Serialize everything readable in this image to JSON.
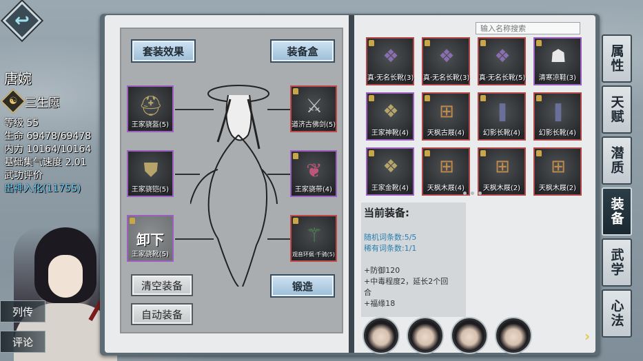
{
  "character": {
    "name": "唐婉",
    "trait": "三生愿",
    "stats": [
      {
        "label": "等级",
        "value": "55"
      },
      {
        "label": "生命",
        "value": "69478/69478"
      },
      {
        "label": "内力",
        "value": "10164/10164"
      },
      {
        "label": "基础集气速度",
        "value": "2.01"
      },
      {
        "label": "武功评价",
        "value": ""
      }
    ],
    "rating": "出神入化(11755)"
  },
  "side_buttons": {
    "biography": "列传",
    "comment": "评论"
  },
  "left_page": {
    "set_effect": "套装效果",
    "equip_box": "装备盒",
    "clear_equip": "清空装备",
    "auto_equip": "自动装备",
    "forge": "锻造",
    "unequip_label": "卸下",
    "slots": {
      "head": "王家骁盔(5)",
      "weapon": "道济古佛剑(5)",
      "armor": "王家骁铠(5)",
      "belt": "王家骁带(4)",
      "boots": "王家骁靴(5)",
      "accessory": "观音环佩·千骑(5)"
    }
  },
  "search": {
    "placeholder": "输入名称搜索"
  },
  "inventory": [
    {
      "name": "真·无名长靴(3)",
      "rarity": "red"
    },
    {
      "name": "真·无名长靴(3)",
      "rarity": "red"
    },
    {
      "name": "真·无名长靴(5)",
      "rarity": "red"
    },
    {
      "name": "清寒凉鞋(3)",
      "rarity": "purple"
    },
    {
      "name": "王家神靴(4)",
      "rarity": "purple"
    },
    {
      "name": "天枫古屐(4)",
      "rarity": "red"
    },
    {
      "name": "幻影长靴(4)",
      "rarity": "red"
    },
    {
      "name": "幻影长靴(4)",
      "rarity": "red"
    },
    {
      "name": "王家金靴(4)",
      "rarity": "purple"
    },
    {
      "name": "天枫木屐(4)",
      "rarity": "red"
    },
    {
      "name": "天枫木屐(2)",
      "rarity": "red"
    },
    {
      "name": "天枫木屐(2)",
      "rarity": "red"
    }
  ],
  "current_equip": {
    "title": "当前装备:",
    "random_affix": "随机词条数:5/5",
    "rare_affix": "稀有词条数:1/1",
    "effects": [
      "+防御120",
      "+中毒程度2，延长2个回",
      "合",
      "+福缘18"
    ]
  },
  "tabs": [
    "属性",
    "天赋",
    "潜质",
    "装备",
    "武学",
    "心法"
  ],
  "active_tab": "装备",
  "colors": {
    "red_border": "#b14747",
    "purple_border": "#9b5fc0",
    "rating": "#6bd3ff"
  }
}
